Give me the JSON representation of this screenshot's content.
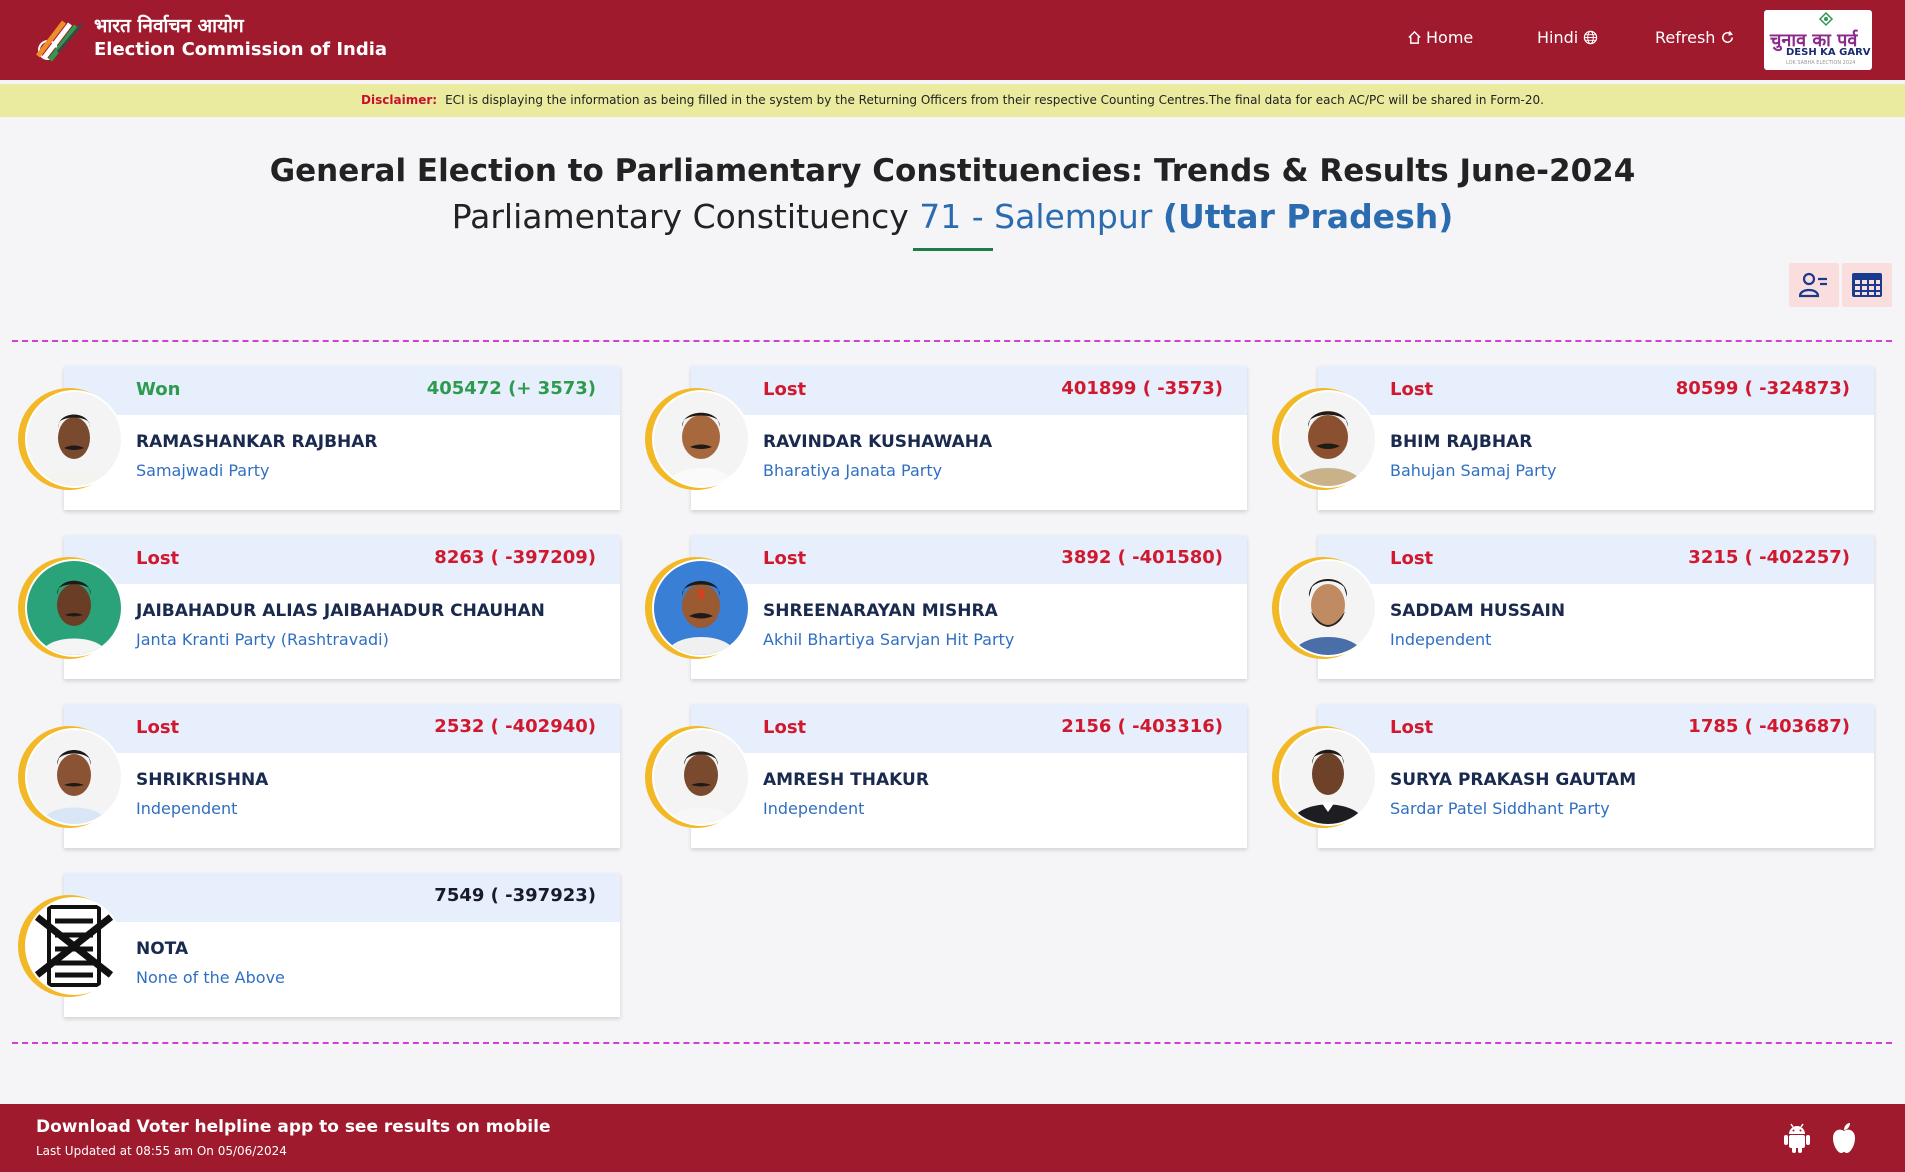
{
  "header": {
    "org_hindi": "भारत निर्वाचन आयोग",
    "org_english": "Election Commission of India",
    "nav": {
      "home": "Home",
      "hindi": "Hindi",
      "refresh": "Refresh"
    },
    "badge": {
      "hindi": "चुनाव का पर्व",
      "english": "DESH KA GARV",
      "small": "LOK SABHA ELECTION 2024"
    }
  },
  "disclaimer": {
    "label": "Disclaimer:",
    "text": "ECI is displaying the information as being filled in the system by the Returning Officers from their respective Counting Centres.The final data for each AC/PC will be shared in Form-20."
  },
  "title": {
    "line1": "General Election to Parliamentary Constituencies: Trends & Results June-2024",
    "pc_prefix": "Parliamentary Constituency",
    "pc_name": "71 - Salempur",
    "state": "(Uttar Pradesh)"
  },
  "candidates": [
    {
      "status": "Won",
      "votes": "405472 (+ 3573)",
      "name": "RAMASHANKAR RAJBHAR",
      "party": "Samajwadi Party"
    },
    {
      "status": "Lost",
      "votes": "401899 ( -3573)",
      "name": "RAVINDAR KUSHAWAHA",
      "party": "Bharatiya Janata Party"
    },
    {
      "status": "Lost",
      "votes": "80599 ( -324873)",
      "name": "BHIM RAJBHAR",
      "party": "Bahujan Samaj Party"
    },
    {
      "status": "Lost",
      "votes": "8263 ( -397209)",
      "name": "JAIBAHADUR ALIAS JAIBAHADUR CHAUHAN",
      "party": "Janta Kranti Party (Rashtravadi)"
    },
    {
      "status": "Lost",
      "votes": "3892 ( -401580)",
      "name": "SHREENARAYAN MISHRA",
      "party": "Akhil Bhartiya Sarvjan Hit Party"
    },
    {
      "status": "Lost",
      "votes": "3215 ( -402257)",
      "name": "SADDAM HUSSAIN",
      "party": "Independent"
    },
    {
      "status": "Lost",
      "votes": "2532 ( -402940)",
      "name": "SHRIKRISHNA",
      "party": "Independent"
    },
    {
      "status": "Lost",
      "votes": "2156 ( -403316)",
      "name": "AMRESH THAKUR",
      "party": "Independent"
    },
    {
      "status": "Lost",
      "votes": "1785 ( -403687)",
      "name": "SURYA PRAKASH GAUTAM",
      "party": "Sardar Patel Siddhant Party"
    },
    {
      "status": "",
      "votes": "7549 ( -397923)",
      "name": "NOTA",
      "party": "None of the Above"
    }
  ],
  "footer": {
    "download_text": "Download Voter helpline app to see results on mobile",
    "last_updated": "Last Updated at 08:55 am On 05/06/2024"
  },
  "icons": {
    "home": "home-icon",
    "language": "globe-icon",
    "refresh": "refresh-icon",
    "candidate_view": "user-list-icon",
    "table_view": "table-icon",
    "android": "android-icon",
    "apple": "apple-icon"
  },
  "colors": {
    "brand": "#a01a2e",
    "won": "#2e9a4e",
    "lost": "#d0182e",
    "party": "#2f6fc2",
    "ring": "#f2b825"
  }
}
